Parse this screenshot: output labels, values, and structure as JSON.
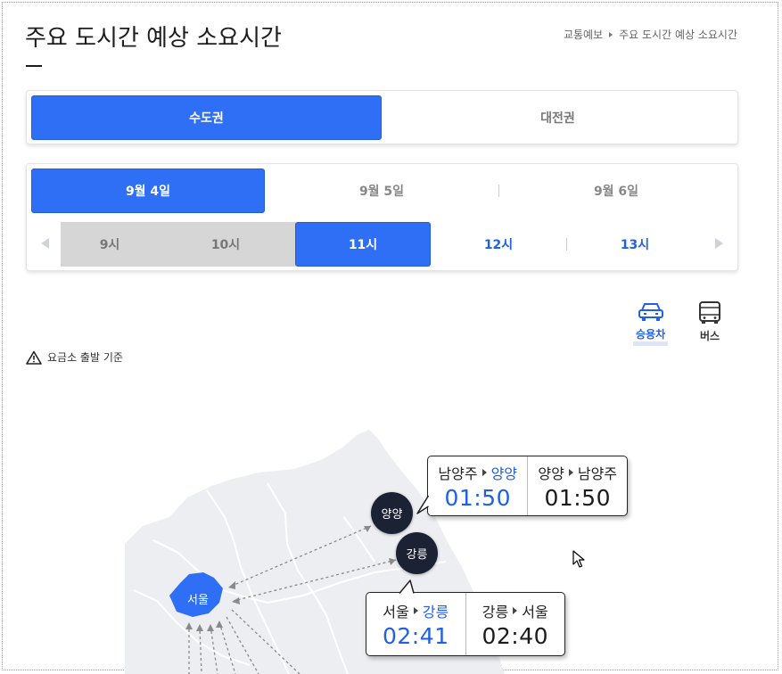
{
  "header": {
    "title": "주요 도시간 예상 소요시간",
    "breadcrumb": [
      "교통예보",
      "주요 도시간 예상 소요시간"
    ]
  },
  "regions": {
    "tabs": [
      {
        "label": "수도권",
        "active": true
      },
      {
        "label": "대전권",
        "active": false
      }
    ]
  },
  "dates": {
    "tabs": [
      {
        "label": "9월 4일",
        "active": true
      },
      {
        "label": "9월 5일",
        "active": false
      },
      {
        "label": "9월 6일",
        "active": false
      }
    ]
  },
  "hours": {
    "tabs": [
      {
        "label": "9시",
        "state": "past"
      },
      {
        "label": "10시",
        "state": "past"
      },
      {
        "label": "11시",
        "state": "active"
      },
      {
        "label": "12시",
        "state": "future"
      },
      {
        "label": "13시",
        "state": "future"
      }
    ]
  },
  "vehicles": {
    "car_label": "승용차",
    "bus_label": "버스",
    "selected": "car"
  },
  "notice": {
    "text": "요금소 출발 기준",
    "icon": "warning-icon"
  },
  "map": {
    "cities": {
      "seoul": "서울",
      "yangyang": "양양",
      "gangneung": "강릉"
    },
    "tooltips": {
      "yangyang": {
        "out": {
          "from": "남양주",
          "to": "양양",
          "time": "01:50"
        },
        "back": {
          "from": "양양",
          "to": "남양주",
          "time": "01:50"
        }
      },
      "gangneung": {
        "out": {
          "from": "서울",
          "to": "강릉",
          "time": "02:41"
        },
        "back": {
          "from": "강릉",
          "to": "서울",
          "time": "02:40"
        }
      }
    }
  },
  "colors": {
    "accent": "#2f6ff5",
    "accent_text": "#2160e6",
    "city_bubble": "#1b2233",
    "seoul_fill": "#2f6ff5",
    "map_land": "#eceef2"
  }
}
